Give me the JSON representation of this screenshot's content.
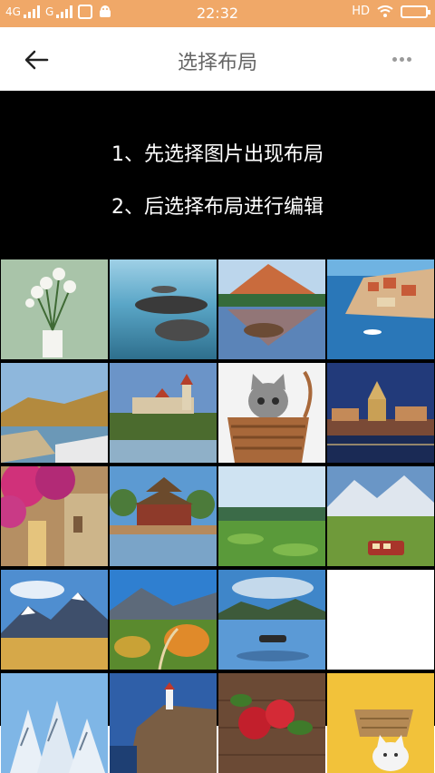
{
  "status_bar": {
    "network1": "4G",
    "network2": "G",
    "time": "22:32",
    "hd": "HD"
  },
  "app_bar": {
    "title": "选择布局"
  },
  "instructions": {
    "line1": "1、先选择图片出现布局",
    "line2": "2、后选择布局进行编辑"
  },
  "grid_items": [
    "flower-vase-thumbnail",
    "seaside-rocks-thumbnail",
    "mountain-lake-thumbnail",
    "coastal-town-thumbnail",
    "rocky-coast-thumbnail",
    "castle-hill-thumbnail",
    "kitten-basket-thumbnail",
    "city-night-thumbnail",
    "flowered-street-thumbnail",
    "palace-tower-thumbnail",
    "green-meadow-thumbnail",
    "mountain-train-thumbnail",
    "snow-peak-thumbnail",
    "autumn-valley-thumbnail",
    "lake-boat-thumbnail",
    "empty-slot",
    "snowy-trees-thumbnail",
    "lighthouse-cliff-thumbnail",
    "red-roses-thumbnail",
    "cat-yellow-thumbnail"
  ]
}
